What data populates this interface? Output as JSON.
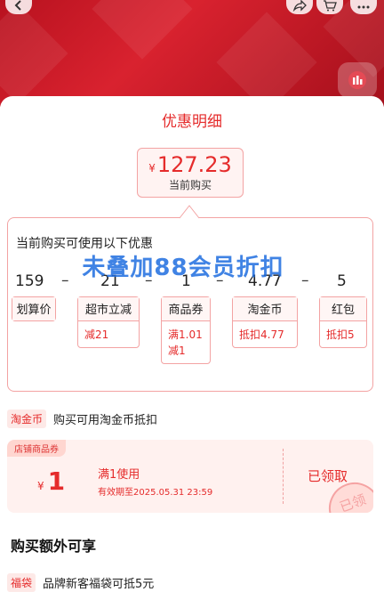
{
  "sheet": {
    "title": "优惠明细"
  },
  "price": {
    "currency": "¥",
    "amount": "127.23",
    "label": "当前购买"
  },
  "detail": {
    "heading": "当前购买可使用以下优惠",
    "numbers": [
      "159",
      "21",
      "1",
      "4.77",
      "5"
    ],
    "operators": [
      "–",
      "–",
      "–",
      "–"
    ],
    "tags": [
      {
        "head": "划算价",
        "body": ""
      },
      {
        "head": "超市立减",
        "body": "减21"
      },
      {
        "head": "商品券",
        "body": "满1.01 减1"
      },
      {
        "head": "淘金币",
        "body": "抵扣4.77"
      },
      {
        "head": "红包",
        "body": "抵扣5"
      }
    ]
  },
  "overlay": {
    "text": "未叠加88会员折扣"
  },
  "coin_row": {
    "badge": "淘金币",
    "text": "购买可用淘金币抵扣"
  },
  "coupon": {
    "type": "店铺商品券",
    "currency": "¥",
    "value": "1",
    "condition": "满1使用",
    "expiry": "有效期至2025.05.31 23:59",
    "status": "已领取",
    "stamp": "已领"
  },
  "extra": {
    "title": "购买额外可享"
  },
  "bag_row": {
    "badge": "福袋",
    "text": "品牌新客福袋可抵5元"
  },
  "colors": {
    "accent": "#e52b2b",
    "overlay_blue": "#1f6ee0",
    "banner_red": "#c41a26"
  },
  "icons": [
    "back-icon",
    "share-icon",
    "cart-icon",
    "more-icon",
    "chart-icon"
  ]
}
